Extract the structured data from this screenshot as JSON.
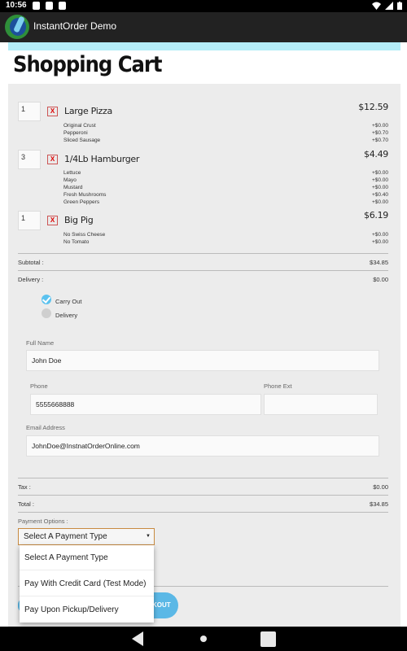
{
  "status_bar": {
    "time": "10:56"
  },
  "app": {
    "title": "InstantOrder Demo"
  },
  "page": {
    "title": "Shopping Cart"
  },
  "cart": {
    "items": [
      {
        "qty": "1",
        "remove": "X",
        "name": "Large Pizza",
        "price": "$12.59",
        "options": [
          {
            "name": "Original Crust",
            "price": "+$0.00"
          },
          {
            "name": "Pepperoni",
            "price": "+$0.70"
          },
          {
            "name": "Sliced Sausage",
            "price": "+$0.70"
          }
        ]
      },
      {
        "qty": "3",
        "remove": "X",
        "name": "1/4Lb Hamburger",
        "price": "$4.49",
        "options": [
          {
            "name": "Lettuce",
            "price": "+$0.00"
          },
          {
            "name": "Mayo",
            "price": "+$0.00"
          },
          {
            "name": "Mustard",
            "price": "+$0.00"
          },
          {
            "name": "Fresh Mushrooms",
            "price": "+$0.40"
          },
          {
            "name": "Green Peppers",
            "price": "+$0.00"
          }
        ]
      },
      {
        "qty": "1",
        "remove": "X",
        "name": "Big Pig",
        "price": "$6.19",
        "options": [
          {
            "name": "No Swiss Cheese",
            "price": "+$0.00"
          },
          {
            "name": "No Tomato",
            "price": "+$0.00"
          }
        ]
      }
    ],
    "subtotal_label": "Subtotal :",
    "subtotal_value": "$34.85",
    "delivery_label": "Delivery :",
    "delivery_value": "$0.00",
    "delivery_options": [
      {
        "label": "Carry Out",
        "checked": true
      },
      {
        "label": "Delivery",
        "checked": false
      }
    ],
    "tax_label": "Tax :",
    "tax_value": "$0.00",
    "total_label": "Total :",
    "total_value": "$34.85"
  },
  "form": {
    "full_name_label": "Full Name",
    "full_name_value": "John Doe",
    "phone_label": "Phone",
    "phone_value": "5555668888",
    "phone_ext_label": "Phone Ext",
    "phone_ext_value": "",
    "email_label": "Email Address",
    "email_value": "JohnDoe@InstnatOrderOnline.com"
  },
  "payment": {
    "label": "Payment Options :",
    "selected": "Select A Payment Type",
    "options": [
      "Select A Payment Type",
      "Pay With Credit Card (Test Mode)",
      "Pay Upon Pickup/Delivery"
    ]
  },
  "checkout": {
    "label_visible": "KOUT"
  },
  "colors": {
    "accent": "#5bc2ef",
    "app_bar": "#222222",
    "accent_bar": "#b3ecf7"
  }
}
